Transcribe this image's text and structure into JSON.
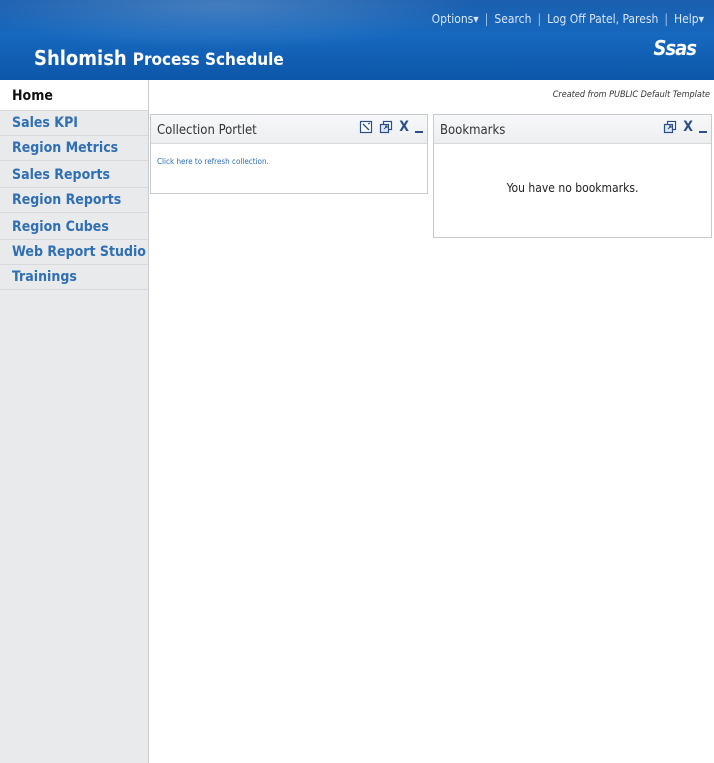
{
  "header": {
    "title_part1": "Shlomish",
    "title_part2": "Process Schedule",
    "logo_text": "Ssas",
    "top_links": {
      "options": "Options▾",
      "search": "Search",
      "logoff": "Log Off Patel, Paresh",
      "help": "Help▾"
    }
  },
  "sidebar": {
    "home": "Home",
    "items": [
      "Sales KPI",
      "Region Metrics",
      "Sales Reports",
      "Region Reports",
      "Region Cubes",
      "Web Report Studio",
      "Trainings"
    ]
  },
  "main": {
    "created_note": "Created from PUBLIC Default Template",
    "collection": {
      "title": "Collection Portlet",
      "refresh_link": "Click here to refresh collection."
    },
    "bookmarks": {
      "title": "Bookmarks",
      "empty_message": "You have no bookmarks."
    }
  },
  "colors": {
    "header": "#1568bf",
    "nav_link": "#2f6fb3",
    "sidebar_bg": "#e9eaec"
  }
}
